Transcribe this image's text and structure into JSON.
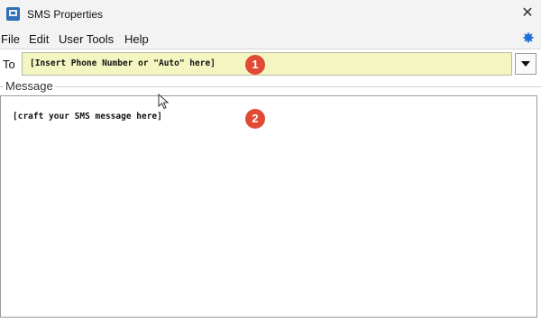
{
  "window": {
    "title": "SMS Properties",
    "close_glyph": "✕",
    "icon": "sms-app-icon"
  },
  "menu": {
    "items": [
      "File",
      "Edit",
      "User Tools",
      "Help"
    ],
    "right_icon": "star-icon"
  },
  "to": {
    "label": "To",
    "value": "[Insert Phone Number or \"Auto\" here]",
    "field_color": "#f4f6c2",
    "dropdown_icon": "chevron-down-icon"
  },
  "message": {
    "group_label": "Message",
    "value": "[craft your SMS message here]"
  },
  "annotations": {
    "badge1": "1",
    "badge2": "2",
    "badge_color": "#e14b36"
  }
}
